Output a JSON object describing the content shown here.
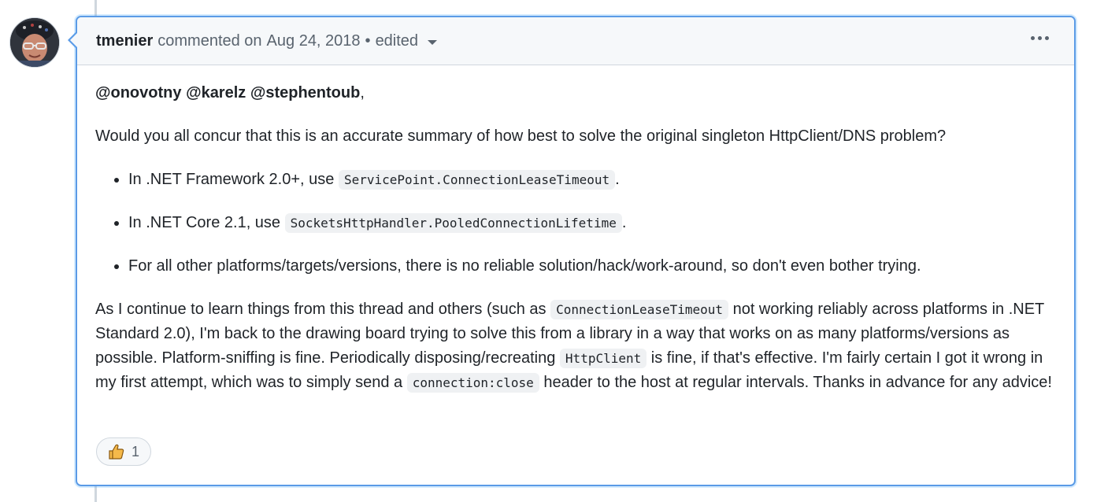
{
  "comment": {
    "author": "tmenier",
    "action": "commented on",
    "date": "Aug 24, 2018",
    "separator": "•",
    "edited_label": "edited",
    "mentions": [
      "@onovotny",
      "@karelz",
      "@stephentoub"
    ],
    "mentions_suffix": ",",
    "intro": "Would you all concur that this is an accurate summary of how best to solve the original singleton HttpClient/DNS problem?",
    "bullets": [
      {
        "prefix": "In .NET Framework 2.0+, use ",
        "code": "ServicePoint.ConnectionLeaseTimeout",
        "suffix": "."
      },
      {
        "prefix": "In .NET Core 2.1, use ",
        "code": "SocketsHttpHandler.PooledConnectionLifetime",
        "suffix": "."
      },
      {
        "text": "For all other platforms/targets/versions, there is no reliable solution/hack/work-around, so don't even bother trying."
      }
    ],
    "closing": {
      "part1": "As I continue to learn things from this thread and others (such as ",
      "code1": "ConnectionLeaseTimeout",
      "part2": " not working reliably across platforms in .NET Standard 2.0), I'm back to the drawing board trying to solve this from a library in a way that works on as many platforms/versions as possible. Platform-sniffing is fine. Periodically disposing/recreating ",
      "code2": "HttpClient",
      "part3": " is fine, if that's effective. I'm fairly certain I got it wrong in my first attempt, which was to simply send a ",
      "code3": "connection:close",
      "part4": " header to the host at regular intervals. Thanks in advance for any advice!"
    },
    "reactions": [
      {
        "emoji": "thumbs-up-icon",
        "count": "1"
      }
    ]
  },
  "colors": {
    "focus_border": "#5b9be6",
    "header_bg": "#f6f8fa",
    "muted_text": "#59636e"
  }
}
